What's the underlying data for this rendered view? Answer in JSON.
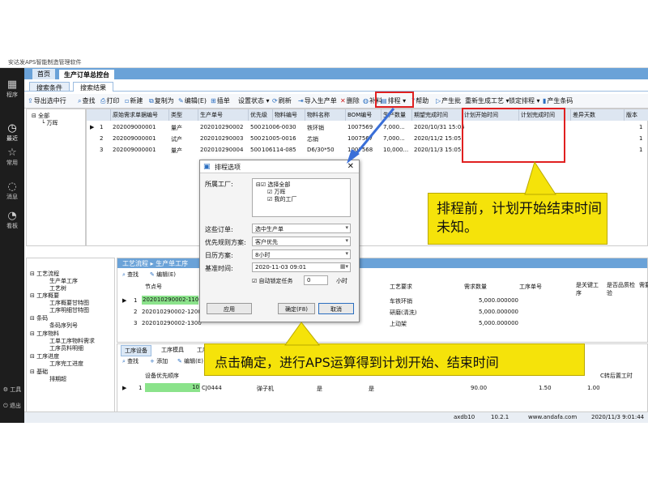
{
  "window": {
    "title": "安达发APS智能制造管理软件"
  },
  "top_tabs": [
    "首页",
    "生产订单总控台"
  ],
  "sidebar": [
    {
      "icon": "apps-icon",
      "label": "程序"
    },
    {
      "icon": "recent-icon",
      "label": "最近"
    },
    {
      "icon": "star-icon",
      "label": "常用"
    },
    {
      "icon": "message-icon",
      "label": "消息"
    },
    {
      "icon": "dashboard-icon",
      "label": "看板"
    },
    {
      "icon": "tools-icon",
      "label": "工具"
    },
    {
      "icon": "exit-icon",
      "label": "退出"
    }
  ],
  "sub_tabs": [
    "搜索条件",
    "搜索结果"
  ],
  "toolbar": {
    "items": [
      "导出选中行",
      "查找",
      "打印",
      "新建",
      "复制为",
      "编辑(E)",
      "插单",
      "设置状态",
      "刷新",
      "导入生产单",
      "删除",
      "补料",
      "排程",
      "帮助",
      "产生批",
      "重新生成工艺",
      "锁定排程",
      "产生条码"
    ]
  },
  "tree_top": {
    "root": "全部",
    "child": "万晖"
  },
  "orders_grid": {
    "columns": [
      "原始需求单据编号",
      "类型",
      "生产单号",
      "优先级",
      "物料编号",
      "物料名称",
      "BOM编号",
      "生产数量",
      "期望完成时间",
      "计划开始时间",
      "计划完成时间",
      "差异天数",
      "版本"
    ],
    "rows": [
      {
        "marker": "▶",
        "no": "1",
        "src": "202009000001",
        "type": "量产",
        "order": "202010290002",
        "prio": "500",
        "mat": "21006-0030",
        "name": "铁环销",
        "bom": "1007569",
        "qty": "7,000...",
        "due": "2020/10/31 15:05",
        "ver": "1"
      },
      {
        "marker": "",
        "no": "2",
        "src": "202009000001",
        "type": "试产",
        "order": "202010290003",
        "prio": "500",
        "mat": "21005-0016",
        "name": "芯销",
        "bom": "1007567",
        "qty": "7,000...",
        "due": "2020/11/2 15:05",
        "ver": "1"
      },
      {
        "marker": "",
        "no": "3",
        "src": "202009000001",
        "type": "量产",
        "order": "202010290004",
        "prio": "500",
        "mat": "106114-085",
        "name": "D6/30*50",
        "bom": "1007568",
        "qty": "10,000...",
        "due": "2020/11/3 15:05",
        "ver": "1"
      }
    ]
  },
  "process_tree": {
    "items": [
      "工艺流程",
      "生产单工序",
      "工艺树",
      "工序概要",
      "工序概要甘特图",
      "工序明细甘特图",
      "条码",
      "条码序列号",
      "工序物料",
      "工单工序物料需求",
      "工序员料明细",
      "工序进度",
      "工序完工进度",
      "基础",
      "排期超"
    ]
  },
  "process_panel": {
    "title": "工艺流程 ▸ 生产单工序",
    "toolbar": [
      "查找",
      "编辑(E)"
    ],
    "columns": [
      "节点号",
      "工艺要求",
      "需求数量",
      "工序单号",
      "是关键工序",
      "是否品质检验",
      "需要"
    ],
    "rows": [
      {
        "no": "1",
        "node": "202010290002-1100",
        "req": "车铁环销",
        "qty": "5,000.000000"
      },
      {
        "no": "2",
        "node": "202010290002-1200",
        "req": "研磨(清洗)",
        "qty": "5,000.000000"
      },
      {
        "no": "3",
        "node": "202010290002-1300",
        "req": "上动架",
        "qty": "5,000.000000"
      }
    ]
  },
  "equipment_panel": {
    "tabs": [
      "工序设备",
      "工序模具",
      "工序人员"
    ],
    "toolbar": [
      "查找",
      "添加",
      "编辑(E)"
    ],
    "columns": [
      "设备优先顺序",
      "C转后置工时"
    ],
    "row": {
      "no": "1",
      "order": "10",
      "code": "CJ0444",
      "name": "弹子机",
      "a": "是",
      "b": "是",
      "v1": "90.00",
      "v2": "1.50",
      "v3": "1.00"
    }
  },
  "status_bar": {
    "db": "axdb10",
    "ip": "10.2.1",
    "site": "www.andafa.com",
    "datetime": "2020/11/3 9:01:44"
  },
  "dialog": {
    "title": "排程选项",
    "factory_label": "所属工厂:",
    "factory_tree": [
      "选择全部",
      "万晖",
      "我的工厂"
    ],
    "order_label": "这些订单:",
    "order_value": "选中生产单",
    "priority_label": "优先规则方案:",
    "priority_value": "客户优先",
    "calendar_label": "日历方案:",
    "calendar_value": "8小时",
    "base_time_label": "基准时间:",
    "base_time_value": "2020-11-03 09:01",
    "auto_lock_label": "自动锁定任务",
    "auto_lock_value": "0",
    "hours_label": "小时",
    "apply_btn": "应用",
    "ok_btn": "确定(F8)",
    "cancel_btn": "取消"
  },
  "callouts": {
    "top": "排程前，计划开始结束时间未知。",
    "bottom": "点击确定，进行APS运算得到计划开始、结束时间"
  },
  "colors": {
    "accent": "#6aa2d8",
    "highlight": "#f5e30a",
    "annotation": "#e02020",
    "arrow": "#3a6fd8"
  }
}
